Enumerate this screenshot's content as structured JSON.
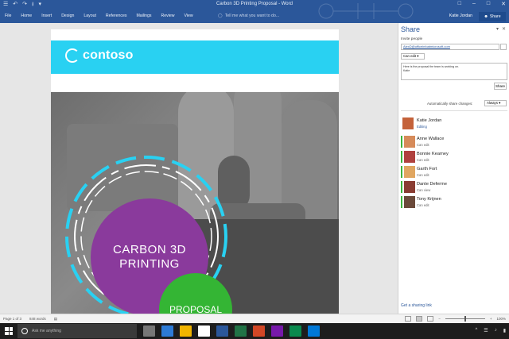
{
  "titlebar": {
    "title": "Carbon 3D Printing Proposal - Word",
    "qat": [
      "☰",
      "↶",
      "↷",
      "⭳",
      "▾"
    ],
    "controls": [
      "□",
      "–",
      "□",
      "✕"
    ]
  },
  "ribbon": {
    "tabs": [
      "File",
      "Home",
      "Insert",
      "Design",
      "Layout",
      "References",
      "Mailings",
      "Review",
      "View"
    ],
    "tell_me": "Tell me what you want to do...",
    "user": "Katie Jordan",
    "share_label": "Share"
  },
  "document": {
    "logo_text": "contoso",
    "headline_line1": "CARBON 3D",
    "headline_line2": "PRINTING",
    "subhead": "PROPOSAL"
  },
  "share_pane": {
    "title": "Share",
    "invite_label": "Invite people",
    "invite_value": "AlexD@officeinfoatmicrosoft.com",
    "permission": "Can edit",
    "message_line1": "Here is the proposal the team is working on.",
    "message_line2": "Katie",
    "share_button": "Share",
    "auto_share_label": "Automatically share changes:",
    "auto_share_value": "Always",
    "people": [
      {
        "name": "Katie Jordan",
        "role": "Editing",
        "color": "#c4623a",
        "blue": true
      },
      {
        "name": "Anne Wallace",
        "role": "Can edit",
        "color": "#d68b5a",
        "blue": false
      },
      {
        "name": "Bonnie Kearney",
        "role": "Can edit",
        "color": "#b0413e",
        "blue": false
      },
      {
        "name": "Garth Fort",
        "role": "Can edit",
        "color": "#e0a660",
        "blue": false
      },
      {
        "name": "Dante Deferme",
        "role": "Can view",
        "color": "#8a3c32",
        "blue": false
      },
      {
        "name": "Tony Krijnen",
        "role": "Can edit",
        "color": "#6b4a3a",
        "blue": false
      }
    ],
    "sharing_link": "Get a sharing link"
  },
  "statusbar": {
    "page": "Page 1 of 3",
    "words": "848 words",
    "zoom": "100%"
  },
  "taskbar": {
    "search_placeholder": "Ask me anything",
    "app_colors": [
      "#777777",
      "#2d7bd6",
      "#f0b400",
      "#ffffff",
      "#2b579a",
      "#217346",
      "#d24726",
      "#7719aa",
      "#0a8a4e",
      "#0078d7"
    ],
    "tray": [
      "^",
      "☰",
      "♪",
      "▮"
    ]
  },
  "colors": {
    "word_blue": "#2b579a",
    "banner_cyan": "#29d1f2",
    "purple": "#8a3a9c",
    "green": "#34b534"
  }
}
